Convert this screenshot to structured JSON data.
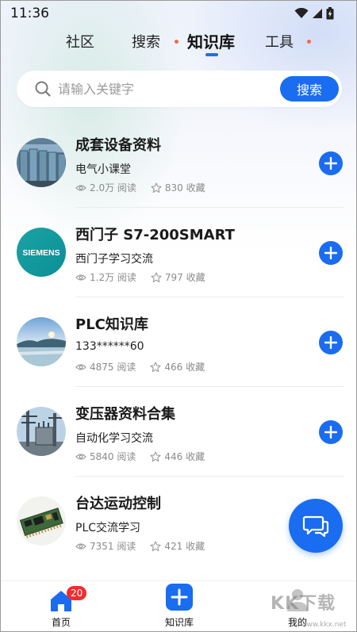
{
  "status_bar": {
    "time": "11:36"
  },
  "tabs": [
    {
      "label": "社区",
      "active": false,
      "dot": false
    },
    {
      "label": "搜索",
      "active": false,
      "dot": true
    },
    {
      "label": "知识库",
      "active": true,
      "dot": false
    },
    {
      "label": "工具",
      "active": false,
      "dot": true
    }
  ],
  "search": {
    "placeholder": "请输入关键字",
    "button_label": "搜索"
  },
  "items": [
    {
      "title": "成套设备资料",
      "subtitle": "电气小课堂",
      "reads": "2.0万 阅读",
      "favorites": "830 收藏",
      "image": "switchgear-cabinets"
    },
    {
      "title": "西门子 S7-200SMART",
      "subtitle": "西门子学习交流",
      "reads": "1.2万 阅读",
      "favorites": "797 收藏",
      "image": "siemens-logo",
      "logo_text": "SIEMENS"
    },
    {
      "title": "PLC知识库",
      "subtitle": "133******60",
      "reads": "4875 阅读",
      "favorites": "466 收藏",
      "image": "lake-landscape"
    },
    {
      "title": "变压器资料合集",
      "subtitle": "自动化学习交流",
      "reads": "5840 阅读",
      "favorites": "446 收藏",
      "image": "substation-transformer"
    },
    {
      "title": "台达运动控制",
      "subtitle": "PLC交流学习",
      "reads": "7351 阅读",
      "favorites": "421 收藏",
      "image": "circuit-board"
    }
  ],
  "bottom_nav": [
    {
      "label": "首页",
      "badge": "20",
      "icon": "home-icon"
    },
    {
      "label": "知识库",
      "icon": "add-square-icon"
    },
    {
      "label": "我的",
      "icon": "profile-icon"
    }
  ],
  "watermark": {
    "text": "KK下载",
    "url": "www.kkx.net"
  },
  "colors": {
    "accent": "#1a6cf0",
    "badge": "#ef2e2e",
    "tab_dot": "#f26a4b"
  }
}
